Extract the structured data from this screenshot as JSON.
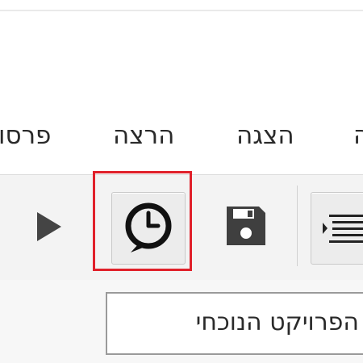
{
  "menu": {
    "items": [
      {
        "label": "ה"
      },
      {
        "label": "הצגה"
      },
      {
        "label": "הרצה"
      },
      {
        "label": "פרסו"
      }
    ]
  },
  "toolbar": {
    "buttons": [
      {
        "icon": "play-icon"
      },
      {
        "icon": "clock-speech-bubble-icon"
      },
      {
        "icon": "save-icon"
      },
      {
        "icon": "list-outline-icon"
      }
    ],
    "highlight_color": "#e0202a"
  },
  "project": {
    "text": "הפרויקט הנוכחי"
  }
}
